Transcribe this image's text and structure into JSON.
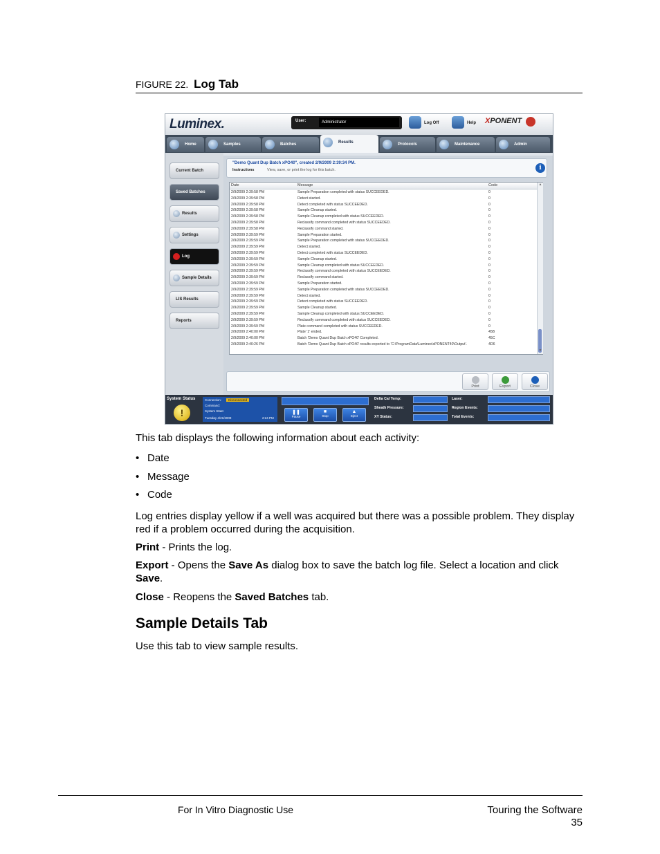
{
  "figure": {
    "number": "FIGURE 22.",
    "title": "Log Tab"
  },
  "app": {
    "logo": "Luminex.",
    "user_label": "User:",
    "user_value": "Administrator",
    "logoff_label": "Log Off",
    "help_label": "Help",
    "brand_x": "X",
    "brand_rest": "PONENT",
    "nav_tabs": [
      "Home",
      "Samples",
      "Batches",
      "Results",
      "Protocols",
      "Maintenance",
      "Admin"
    ],
    "active_tab": "Results",
    "sidebar": [
      "Current Batch",
      "Saved Batches",
      "Results",
      "Settings",
      "Log",
      "Sample Details",
      "LIS Results",
      "Reports"
    ],
    "header_title": "\"Demo Quant Dup Batch xPO40\", created 2/9/2009 2:39:34 PM.",
    "instructions_label": "Instructions",
    "instructions_text": "View, save, or print the log for this batch.",
    "info_icon_glyph": "i",
    "columns": [
      "Date",
      "Message",
      "Code"
    ],
    "rows": [
      [
        "2/9/2009 2:39:58 PM",
        "Sample Preparation completed with status SUCCEEDED.",
        "0"
      ],
      [
        "2/9/2009 2:39:58 PM",
        "Detect started.",
        "0"
      ],
      [
        "2/9/2009 2:39:58 PM",
        "Detect completed with status SUCCEEDED.",
        "0"
      ],
      [
        "2/9/2009 2:39:58 PM",
        "Sample Cleanup started.",
        "0"
      ],
      [
        "2/9/2009 2:39:58 PM",
        "Sample Cleanup completed with status SUCCEEDED.",
        "0"
      ],
      [
        "2/9/2009 2:39:58 PM",
        "Reclassify command completed with status SUCCEEDED.",
        "0"
      ],
      [
        "2/9/2009 2:39:58 PM",
        "Reclassify command started.",
        "0"
      ],
      [
        "2/9/2009 2:39:59 PM",
        "Sample Preparation started.",
        "0"
      ],
      [
        "2/9/2009 2:39:59 PM",
        "Sample Preparation completed with status SUCCEEDED.",
        "0"
      ],
      [
        "2/9/2009 2:39:59 PM",
        "Detect started.",
        "0"
      ],
      [
        "2/9/2009 2:39:59 PM",
        "Detect completed with status SUCCEEDED.",
        "0"
      ],
      [
        "2/9/2009 2:39:59 PM",
        "Sample Cleanup started.",
        "0"
      ],
      [
        "2/9/2009 2:39:59 PM",
        "Sample Cleanup completed with status SUCCEEDED.",
        "0"
      ],
      [
        "2/9/2009 2:39:59 PM",
        "Reclassify command completed with status SUCCEEDED.",
        "0"
      ],
      [
        "2/9/2009 2:39:59 PM",
        "Reclassify command started.",
        "0"
      ],
      [
        "2/9/2009 2:39:59 PM",
        "Sample Preparation started.",
        "0"
      ],
      [
        "2/9/2009 2:39:59 PM",
        "Sample Preparation completed with status SUCCEEDED.",
        "0"
      ],
      [
        "2/9/2009 2:39:59 PM",
        "Detect started.",
        "0"
      ],
      [
        "2/9/2009 2:39:59 PM",
        "Detect completed with status SUCCEEDED.",
        "0"
      ],
      [
        "2/9/2009 2:39:59 PM",
        "Sample Cleanup started.",
        "0"
      ],
      [
        "2/9/2009 2:39:59 PM",
        "Sample Cleanup completed with status SUCCEEDED.",
        "0"
      ],
      [
        "2/9/2009 2:39:59 PM",
        "Reclassify command completed with status SUCCEEDED.",
        "0"
      ],
      [
        "2/9/2009 2:39:59 PM",
        "Plate command completed with status SUCCEEDED.",
        "0"
      ],
      [
        "2/9/2009 2:40:00 PM",
        "Plate '1' ended.",
        "45B"
      ],
      [
        "2/9/2009 2:40:00 PM",
        "Batch 'Demo Quant Dup Batch xPO40' Completed.",
        "45C"
      ],
      [
        "2/9/2009 2:40:26 PM",
        "Batch 'Demo Quant Dup Batch xPO40' results exported to 'C:\\ProgramData\\Luminex\\xPONENT40\\Output'.",
        "4D6"
      ]
    ],
    "footer_buttons": [
      "Print",
      "Export",
      "Close"
    ],
    "status": {
      "title": "System Status",
      "warning_glyph": "!",
      "connection_label": "Connection:",
      "connection_value": "Disconnected",
      "command_label": "Command:",
      "state_label": "System State:",
      "date": "Tuesday 4/21/2009",
      "time": "2:24 PM",
      "controls": [
        "Pause",
        "Stop",
        "Eject"
      ],
      "metrics_left": [
        "Delta Cal Temp:",
        "Sheath Pressure:",
        "XY Status:"
      ],
      "metrics_right": [
        "Laser:",
        "Region Events:",
        "Total Events:"
      ]
    }
  },
  "body": {
    "intro": "This tab displays the following information about each activity:",
    "bullets": [
      "Date",
      "Message",
      "Code"
    ],
    "bullet_glyph": "•",
    "log_colors": "Log entries display yellow if a well was acquired but there was a possible problem. They display red if a problem occurred during the acquisition.",
    "print_term": "Print",
    "print_desc": " - Prints the log.",
    "export_term": "Export",
    "export_desc1": " - Opens the ",
    "export_save_as": "Save As",
    "export_desc2": " dialog box to save the batch log file. Select a location and click ",
    "export_save": "Save",
    "export_end": ".",
    "close_term": "Close",
    "close_desc1": " - Reopens the ",
    "close_saved": "Saved Batches",
    "close_desc2": " tab.",
    "section_heading": "Sample Details Tab",
    "section_text": "Use this tab to view sample results."
  },
  "footer": {
    "left": "For In Vitro Diagnostic Use",
    "right": "Touring the Software",
    "page": "35"
  },
  "colors": {
    "accent_blue": "#1d52a8",
    "log_active_red": "#d41f1f",
    "warning_yellow": "#e0b21a"
  }
}
